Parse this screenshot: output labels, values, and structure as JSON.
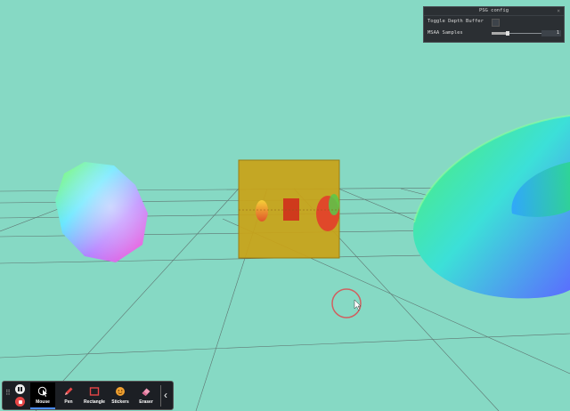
{
  "config_panel": {
    "title": "PSG config",
    "close_glyph": "×",
    "toggle_label": "Toggle Depth Buffer",
    "toggle_checked": false,
    "msaa_label": "MSAA Samples",
    "msaa_value": "1",
    "msaa_fraction": 0.0
  },
  "toolbar": {
    "tools": [
      {
        "label": "Mouse",
        "icon": "mouse-cursor-icon",
        "active": true
      },
      {
        "label": "Pen",
        "icon": "pen-icon",
        "active": false
      },
      {
        "label": "Rectangle",
        "icon": "rectangle-icon",
        "active": false
      },
      {
        "label": "Stickers",
        "icon": "sticker-icon",
        "active": false
      },
      {
        "label": "Eraser",
        "icon": "eraser-icon",
        "active": false
      }
    ],
    "collapse_glyph": "‹"
  },
  "colors": {
    "background": "#86d9c4",
    "cube": "#c9a318",
    "toolbar_bg": "#1c1f24",
    "active_tool_underline": "#4a8cff",
    "stop_red": "#e64646",
    "cursor_ring": "#d06060"
  }
}
